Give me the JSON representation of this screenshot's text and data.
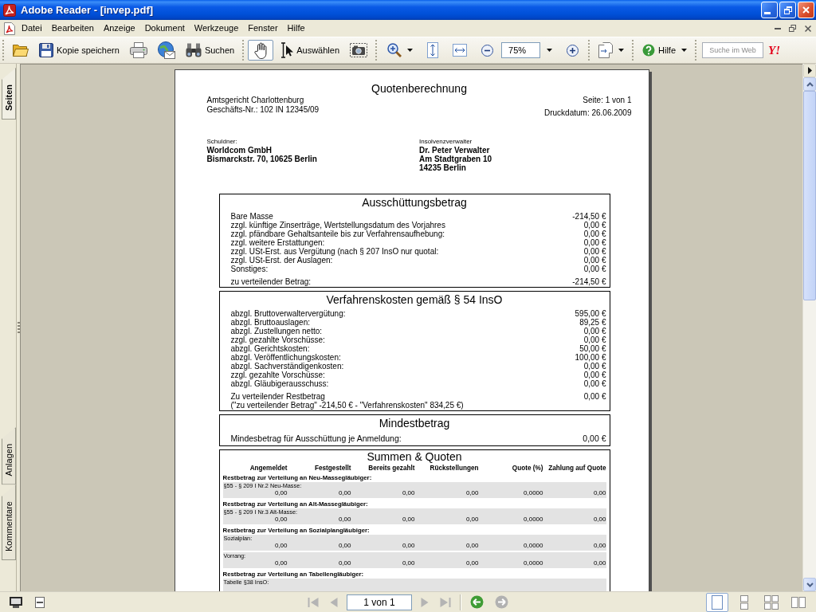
{
  "window": {
    "title": "Adobe Reader - [invep.pdf]"
  },
  "menu_bar": {
    "items": [
      "Datei",
      "Bearbeiten",
      "Anzeige",
      "Dokument",
      "Werkzeuge",
      "Fenster",
      "Hilfe"
    ]
  },
  "toolbar": {
    "groups": [
      {
        "items": [
          {
            "kind": "open"
          },
          {
            "kind": "save",
            "label": "Kopie speichern"
          },
          {
            "kind": "print"
          },
          {
            "kind": "email"
          },
          {
            "kind": "search",
            "label": "Suchen"
          }
        ]
      },
      {
        "items": [
          {
            "kind": "hand",
            "selected": true
          },
          {
            "kind": "select",
            "label": "Auswählen",
            "selected": false
          },
          {
            "kind": "snapshot",
            "selected": false
          }
        ]
      },
      {
        "items": [
          {
            "kind": "zoom_tool"
          },
          {
            "kind": "fit_page"
          },
          {
            "kind": "fit_width"
          },
          {
            "kind": "zoom_out"
          },
          {
            "kind": "zoom_field",
            "value": "75%"
          },
          {
            "kind": "zoom_in"
          }
        ]
      },
      {
        "items": [
          {
            "kind": "pages"
          }
        ]
      },
      {
        "items": [
          {
            "kind": "help",
            "label": "Hilfe"
          }
        ]
      },
      {
        "items": [
          {
            "kind": "web_search",
            "placeholder": "Suche im Web"
          },
          {
            "kind": "logo",
            "text": "Y!"
          }
        ]
      }
    ]
  },
  "navigation_pane": {
    "tabs": [
      {
        "label": "Seiten",
        "selected": true
      },
      {
        "label": "Anlagen",
        "selected": false
      },
      {
        "label": "Kommentare",
        "selected": false
      }
    ]
  },
  "document": {
    "title": "Quotenberechnung",
    "court_lines": [
      "Amtsgericht Charlottenburg",
      "Geschäfts-Nr.: 102 IN 12345/09"
    ],
    "page_info": "Seite: 1 von 1",
    "print_date": "Druckdatum: 26.06.2009",
    "parties": [
      {
        "label": "Schuldner:",
        "lines": [
          "Worldcom GmbH",
          "Bismarckstr. 70, 10625 Berlin"
        ]
      },
      {
        "label": "Insolvenzverwalter",
        "lines": [
          "Dr. Peter Verwalter",
          "Am Stadtgraben 10",
          "14235 Berlin"
        ]
      }
    ],
    "sections": [
      {
        "kind": "amounts",
        "title": "Ausschüttungsbetrag",
        "rows": [
          {
            "label": "Bare Masse",
            "value": "-214,50 €"
          },
          {
            "label": "zzgl. künftige Zinserträge, Wertstellungsdatum des Vorjahres",
            "value": "0,00 €"
          },
          {
            "label": "zzgl. pfändbare Gehaltsanteile bis zur Verfahrensaufhebung:",
            "value": "0,00 €"
          },
          {
            "label": "zzgl. weitere Erstattungen:",
            "value": "0,00 €"
          },
          {
            "label": "zzgl. USt-Erst. aus Vergütung (nach § 207 InsO nur quotal:",
            "value": "0,00 €"
          },
          {
            "label": "zzgl. USt-Erst. der Auslagen:",
            "value": "0,00 €"
          },
          {
            "label": "Sonstiges:",
            "value": "0,00 €"
          }
        ],
        "total": {
          "label": "zu verteilender Betrag:",
          "value": "-214,50 €"
        }
      },
      {
        "kind": "amounts",
        "title": "Verfahrenskosten gemäß § 54 InsO",
        "rows": [
          {
            "label": "abzgl. Bruttoverwaltervergütung:",
            "value": "595,00 €"
          },
          {
            "label": "abzgl. Bruttoauslagen:",
            "value": "89,25 €"
          },
          {
            "label": "abzgl. Zustellungen netto:",
            "value": "0,00 €"
          },
          {
            "label": "zzgl. gezahlte Vorschüsse:",
            "value": "0,00 €"
          },
          {
            "label": "abzgl. Gerichtskosten:",
            "value": "50,00 €"
          },
          {
            "label": "abzgl. Veröffentlichungskosten:",
            "value": "100,00 €"
          },
          {
            "label": "abzgl. Sachverständigenkosten:",
            "value": "0,00 €"
          },
          {
            "label": "zzgl. gezahlte Vorschüsse:",
            "value": "0,00 €"
          },
          {
            "label": "abzgl. Gläubigerausschuss:",
            "value": "0,00 €"
          }
        ],
        "total": {
          "label": "Zu verteilender Restbetrag",
          "value": "0,00 €",
          "note": "(\"zu verteilender Betrag\" -214,50 € - \"Verfahrenskosten\" 834,25 €)"
        }
      },
      {
        "kind": "amounts",
        "title": "Mindestbetrag",
        "rows": [
          {
            "label": "Mindesbetrag für Ausschüttung je Anmeldung:",
            "value": "0,00 €"
          }
        ]
      },
      {
        "kind": "table",
        "title": "Summen & Quoten",
        "columns": [
          "Angemeldet",
          "Festgestellt",
          "Bereits gezahlt",
          "Rückstellungen",
          "Quote (%)",
          "Zahlung auf Quote"
        ],
        "groups": [
          {
            "heading": "Restbetrag zur Verteilung an Neu-Massegläubiger:",
            "items": [
              {
                "label": "§55 - § 209 I Nr.2 Neu-Masse:",
                "values": [
                  "0,00",
                  "0,00",
                  "0,00",
                  "0,00",
                  "0,0000",
                  "0,00"
                ]
              }
            ]
          },
          {
            "heading": "Restbetrag zur Verteilung an Alt-Massegläubiger:",
            "items": [
              {
                "label": "§55 - § 209 I Nr.3 Alt-Masse:",
                "values": [
                  "0,00",
                  "0,00",
                  "0,00",
                  "0,00",
                  "0,0000",
                  "0,00"
                ]
              }
            ]
          },
          {
            "heading": "Restbetrag zur Verteilung an Sozialplangläubiger:",
            "items": [
              {
                "label": "Sozialplan:",
                "values": [
                  "0,00",
                  "0,00",
                  "0,00",
                  "0,00",
                  "0,0000",
                  "0,00"
                ]
              },
              {
                "label": "Vorrang:",
                "values": [
                  "0,00",
                  "0,00",
                  "0,00",
                  "0,00",
                  "0,0000",
                  "0,00"
                ]
              }
            ]
          },
          {
            "heading": "Restbetrag zur Verteilung an Tabellengläubiger:",
            "items": [
              {
                "label": "Tabelle §38 InsO:"
              }
            ]
          }
        ]
      }
    ]
  },
  "status_bar": {
    "navigation_buttons": [
      {
        "kind": "first",
        "disabled": true
      },
      {
        "kind": "previous",
        "disabled": true
      },
      {
        "kind": "next",
        "disabled": true
      },
      {
        "kind": "last",
        "disabled": true
      }
    ],
    "page_field": "1 von 1",
    "history_buttons": [
      {
        "kind": "back",
        "disabled": false
      },
      {
        "kind": "forward",
        "disabled": true
      }
    ],
    "page_layouts": [
      {
        "kind": "single",
        "selected": true
      },
      {
        "kind": "continuous",
        "selected": false
      },
      {
        "kind": "continuous_facing",
        "selected": false
      },
      {
        "kind": "facing",
        "selected": false
      }
    ]
  }
}
